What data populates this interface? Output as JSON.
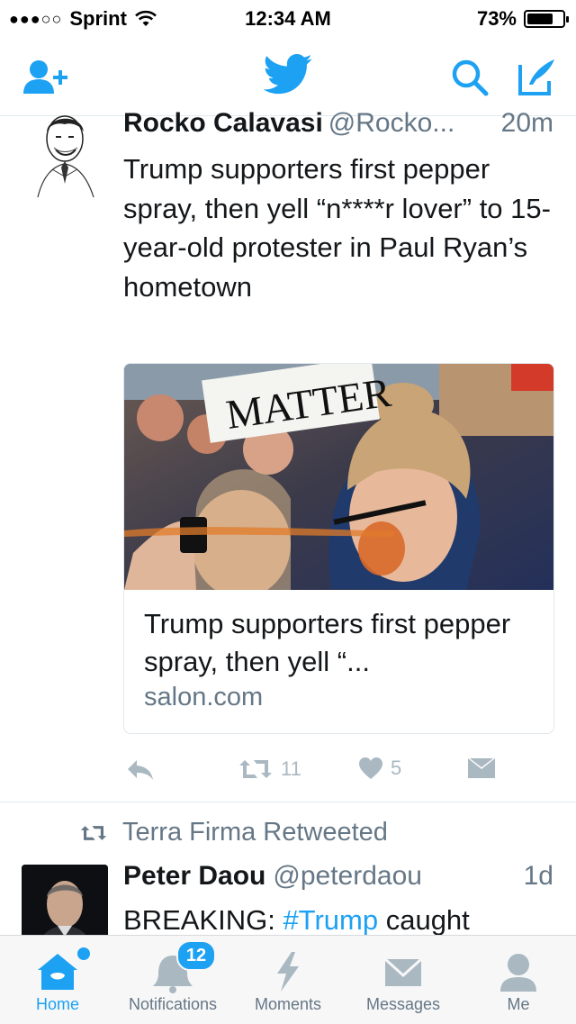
{
  "status_bar": {
    "signal": "●●●○○",
    "carrier": "Sprint",
    "time": "12:34 AM",
    "battery_percent_label": "73%",
    "battery_level": 0.73
  },
  "nav": {
    "icons": [
      "add-user-icon",
      "twitter-bird-icon",
      "search-icon",
      "compose-icon"
    ]
  },
  "tweets": [
    {
      "name": "Rocko Calavasi",
      "handle": "@Rocko...",
      "time": "20m",
      "text": "Trump supporters first pepper spray, then yell “n****r lover” to 15-year-old protester in Paul Ryan’s hometown",
      "card": {
        "title": "Trump supporters first pepper spray, then yell “...",
        "domain": "salon.com",
        "sign_text": "MATTER"
      },
      "actions": {
        "retweets": "11",
        "likes": "5"
      }
    },
    {
      "retweet_context": "Terra Firma Retweeted",
      "name": "Peter Daou",
      "handle": "@peterdaou",
      "time": "1d",
      "text_prefix": "BREAKING: ",
      "hashtag": "#Trump",
      "text_suffix": " caught"
    }
  ],
  "tab_bar": {
    "tabs": [
      {
        "label": "Home",
        "icon": "home-icon",
        "active": true
      },
      {
        "label": "Notifications",
        "icon": "bell-icon",
        "active": false
      },
      {
        "label": "Moments",
        "icon": "lightning-icon",
        "active": false
      },
      {
        "label": "Messages",
        "icon": "envelope-icon",
        "active": false
      },
      {
        "label": "Me",
        "icon": "person-icon",
        "active": false
      }
    ],
    "notifications_badge": "12"
  },
  "colors": {
    "twitter_blue": "#1da1f2",
    "secondary_text": "#657786",
    "action_gray": "#aab8c2"
  }
}
